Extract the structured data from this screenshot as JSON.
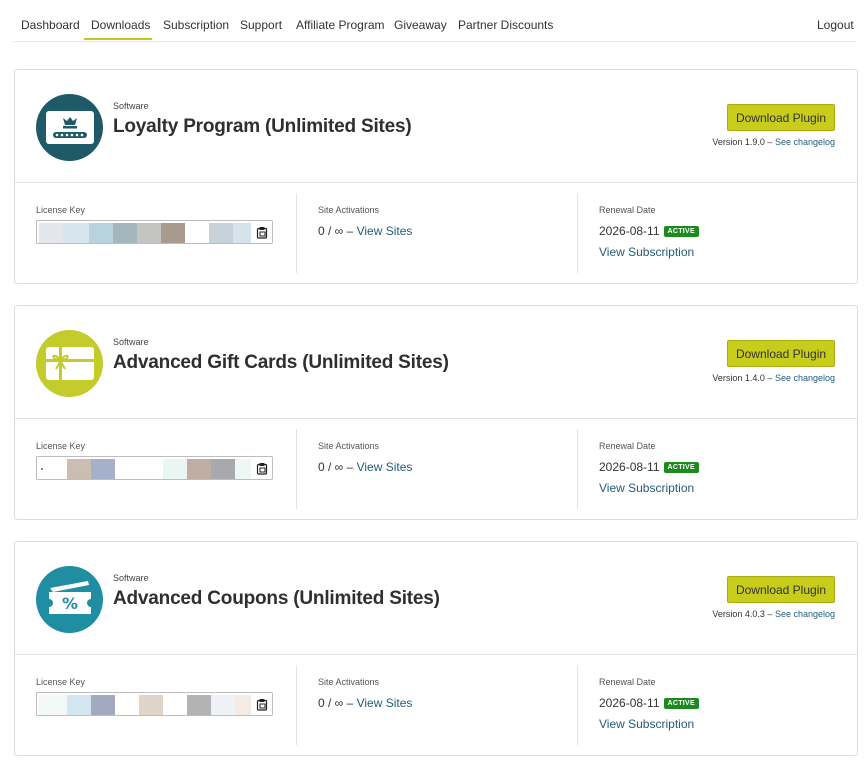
{
  "nav": {
    "items": [
      {
        "label": "Dashboard"
      },
      {
        "label": "Downloads"
      },
      {
        "label": "Subscription"
      },
      {
        "label": "Support"
      },
      {
        "label": "Affiliate Program"
      },
      {
        "label": "Giveaway"
      },
      {
        "label": "Partner Discounts"
      }
    ],
    "active": "Downloads",
    "logout": "Logout"
  },
  "colors": {
    "accent": "#c8cc1b",
    "link": "#1f5d7a",
    "active_badge": "#1c8a1c"
  },
  "products": [
    {
      "category": "Software",
      "title": "Loyalty Program (Unlimited Sites)",
      "icon": "loyalty-card-crown-icon",
      "icon_color": "#1e5a67",
      "download_label": "Download Plugin",
      "version_text": "Version 1.9.0 – ",
      "changelog_label": "See changelog",
      "license_label": "License Key",
      "activations_label": "Site Activations",
      "activations_value": "0 / ∞ – ",
      "view_sites_label": "View Sites",
      "renewal_label": "Renewal Date",
      "renewal_date": "2026-08-11",
      "status": "ACTIVE",
      "view_subscription_label": "View Subscription"
    },
    {
      "category": "Software",
      "title": "Advanced Gift Cards (Unlimited Sites)",
      "icon": "gift-card-icon",
      "icon_color": "#c3cc2a",
      "download_label": "Download Plugin",
      "version_text": "Version 1.4.0 – ",
      "changelog_label": "See changelog",
      "license_label": "License Key",
      "activations_label": "Site Activations",
      "activations_value": "0 / ∞ – ",
      "view_sites_label": "View Sites",
      "renewal_label": "Renewal Date",
      "renewal_date": "2026-08-11",
      "status": "ACTIVE",
      "view_subscription_label": "View Subscription"
    },
    {
      "category": "Software",
      "title": "Advanced Coupons (Unlimited Sites)",
      "icon": "coupon-percent-icon",
      "icon_color": "#1f8ea3",
      "download_label": "Download Plugin",
      "version_text": "Version 4.0.3 – ",
      "changelog_label": "See changelog",
      "license_label": "License Key",
      "activations_label": "Site Activations",
      "activations_value": "0 / ∞ – ",
      "view_sites_label": "View Sites",
      "renewal_label": "Renewal Date",
      "renewal_date": "2026-08-11",
      "status": "ACTIVE",
      "view_subscription_label": "View Subscription"
    }
  ]
}
